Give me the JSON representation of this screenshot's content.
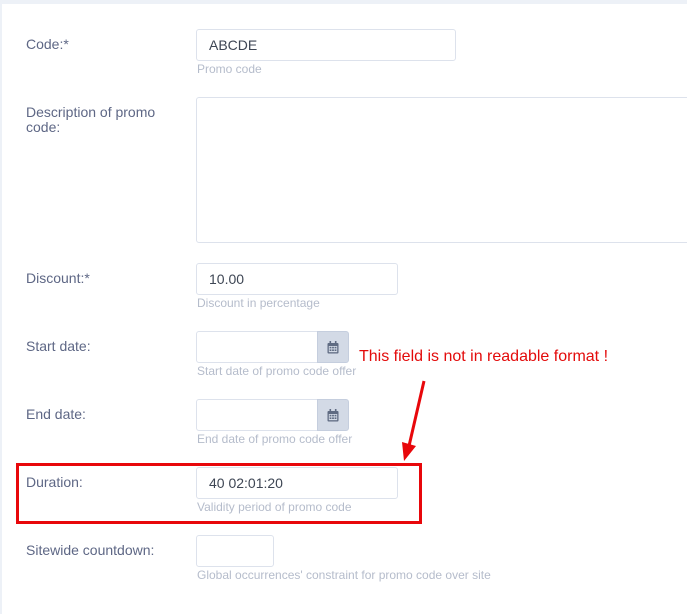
{
  "fields": {
    "code": {
      "label": "Code:*",
      "value": "ABCDE",
      "help": "Promo code"
    },
    "description": {
      "label": "Description of promo code:",
      "value": ""
    },
    "discount": {
      "label": "Discount:*",
      "value": "10.00",
      "help": "Discount in percentage"
    },
    "start_date": {
      "label": "Start date:",
      "value": "",
      "help": "Start date of promo code offer",
      "icon": "calendar-icon"
    },
    "end_date": {
      "label": "End date:",
      "value": "",
      "help": "End date of promo code offer",
      "icon": "calendar-icon"
    },
    "duration": {
      "label": "Duration:",
      "value": "40 02:01:20",
      "help": "Validity period of promo code"
    },
    "sitewide": {
      "label": "Sitewide countdown:",
      "value": "",
      "help": "Global occurrences' constraint for promo code over site"
    }
  },
  "annotation": {
    "text": "This field is not in readable format !",
    "color": "#e8070b"
  }
}
